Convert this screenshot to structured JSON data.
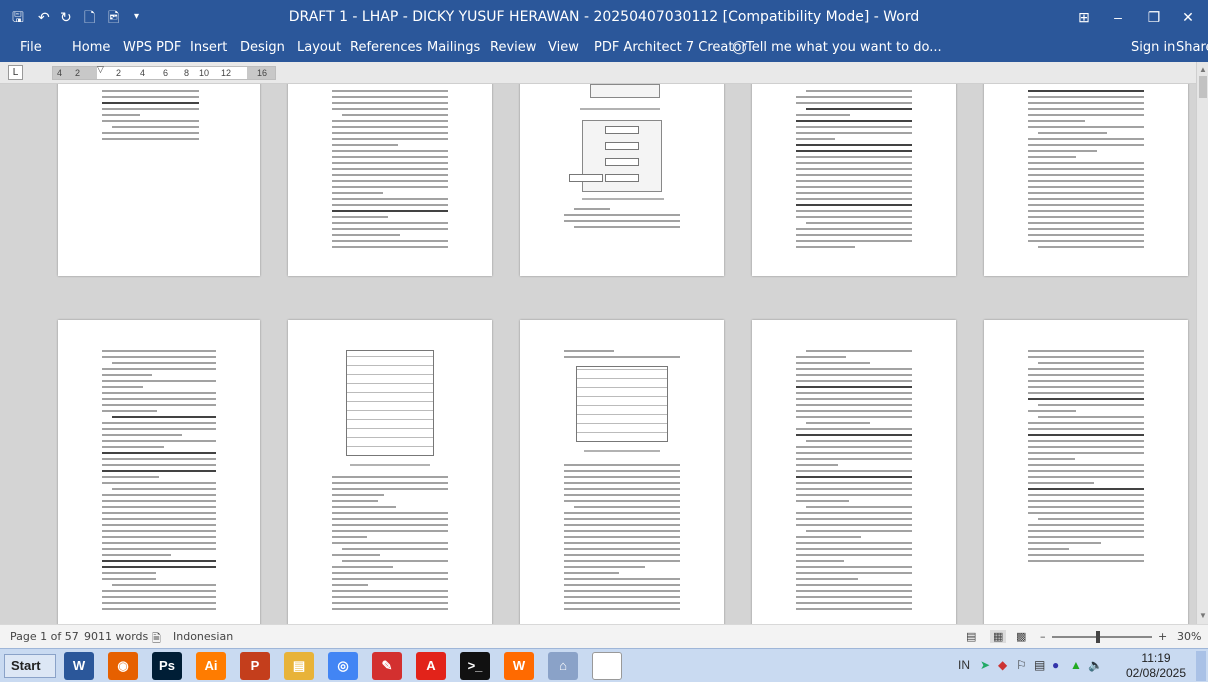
{
  "window": {
    "title": "DRAFT 1 - LHAP - DICKY YUSUF HERAWAN - 20250407030112 [Compatibility Mode] - Word",
    "minimize": "–",
    "restore": "❐",
    "close": "✕",
    "ribbon_display": "⊞"
  },
  "quick_access": {
    "save": "🖫",
    "undo": "↶",
    "redo": "↻",
    "new": "🗋",
    "print_preview": "🖻",
    "more": "▾"
  },
  "ribbon": {
    "tabs": [
      "File",
      "Home",
      "WPS PDF",
      "Insert",
      "Design",
      "Layout",
      "References",
      "Mailings",
      "Review",
      "View",
      "PDF Architect 7 Creator"
    ],
    "tell_me": "Tell me what you want to do...",
    "sign_in": "Sign in",
    "share": "Share"
  },
  "ruler": {
    "tab_marker": "L",
    "numbers": [
      "4",
      "2",
      "2",
      "4",
      "6",
      "8",
      "10",
      "12",
      "16"
    ]
  },
  "statusbar": {
    "page": "Page 1 of 57",
    "words": "9011 words",
    "language": "Indonesian",
    "zoom": "30%",
    "zoom_minus": "–",
    "zoom_plus": "+"
  },
  "taskbar": {
    "start": "Start",
    "apps": [
      {
        "name": "word",
        "label": "W",
        "color": "#2b579a"
      },
      {
        "name": "firefox",
        "label": "◉",
        "color": "#e66000"
      },
      {
        "name": "photoshop",
        "label": "Ps",
        "color": "#001e36"
      },
      {
        "name": "illustrator",
        "label": "Ai",
        "color": "#ff7c00"
      },
      {
        "name": "powerpoint",
        "label": "P",
        "color": "#c43e1c"
      },
      {
        "name": "file-explorer",
        "label": "▤",
        "color": "#e8b339"
      },
      {
        "name": "chrome",
        "label": "◎",
        "color": "#4285f4"
      },
      {
        "name": "pdf-tool",
        "label": "✎",
        "color": "#d3302f"
      },
      {
        "name": "acrobat",
        "label": "A",
        "color": "#e2231a"
      },
      {
        "name": "terminal",
        "label": ">_",
        "color": "#111111"
      },
      {
        "name": "wps",
        "label": "W",
        "color": "#ff6a00"
      },
      {
        "name": "network-app",
        "label": "⌂",
        "color": "#8aa2c8"
      },
      {
        "name": "blank-doc",
        "label": "",
        "color": "#ffffff"
      }
    ],
    "tray_lang": "IN",
    "time": "11:19",
    "date": "02/08/2025"
  }
}
